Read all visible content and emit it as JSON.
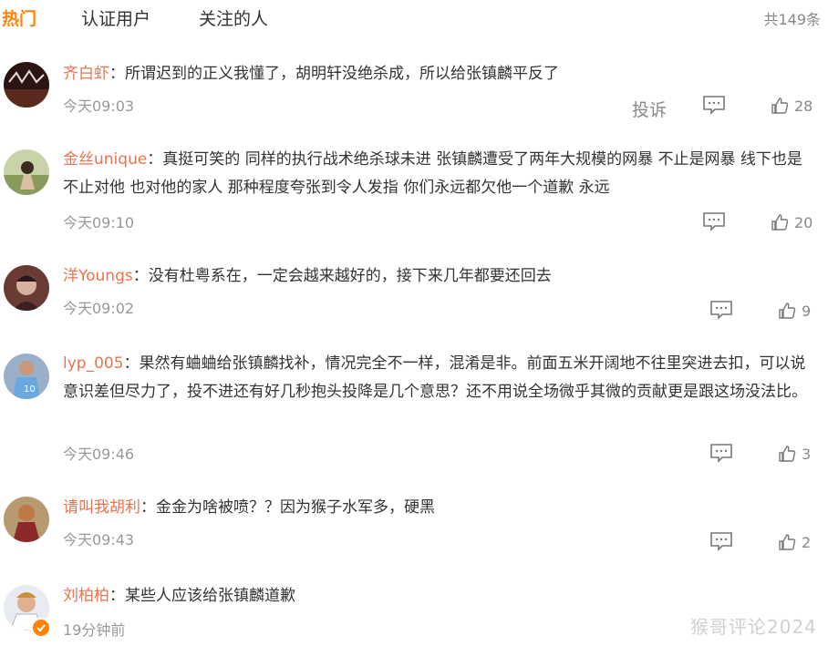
{
  "tabs": [
    "热门",
    "认证用户",
    "关注的人"
  ],
  "total": "共149条",
  "report_label": "投诉",
  "comments": [
    {
      "user": "齐白虾",
      "text": "所谓迟到的正义我懂了，胡明轩没绝杀成，所以给张镇麟平反了",
      "time": "今天09:03",
      "likes": "28"
    },
    {
      "user": "金丝unique",
      "text": "真挺可笑的 同样的执行战术绝杀球未进 张镇麟遭受了两年大规模的网暴 不止是网暴 线下也是 不止对他 也对他的家人 那种程度夸张到令人发指 你们永远都欠他一个道歉 永远",
      "time": "今天09:10",
      "likes": "20"
    },
    {
      "user": "洋Youngs",
      "text": "没有杜粤系在，一定会越来越好的，接下来几年都要还回去",
      "time": "今天09:02",
      "likes": "9"
    },
    {
      "user": "lyp_005",
      "text": "果然有蛐蛐给张镇麟找补，情况完全不一样，混淆是非。前面五米开阔地不往里突进去扣，可以说意识差但尽力了，投不进还有好几秒抱头投降是几个意思？还不用说全场微乎其微的贡献更是跟这场没法比。",
      "time": "今天09:46",
      "likes": "3"
    },
    {
      "user": "请叫我胡利",
      "text": "金金为啥被喷？？因为猴子水军多，硬黑",
      "time": "今天09:43",
      "likes": "2"
    },
    {
      "user": "刘柏柏",
      "text": "某些人应该给张镇麟道歉",
      "time": "19分钟前",
      "likes": ""
    }
  ],
  "watermark": "猴哥评论2024",
  "colors": {
    "accent": "#ff8200",
    "username": "#eb7350",
    "meta": "#999999"
  },
  "icons": {
    "comment": "comment-bubble-icon",
    "like": "thumbs-up-icon",
    "verified": "verified-badge-icon"
  }
}
